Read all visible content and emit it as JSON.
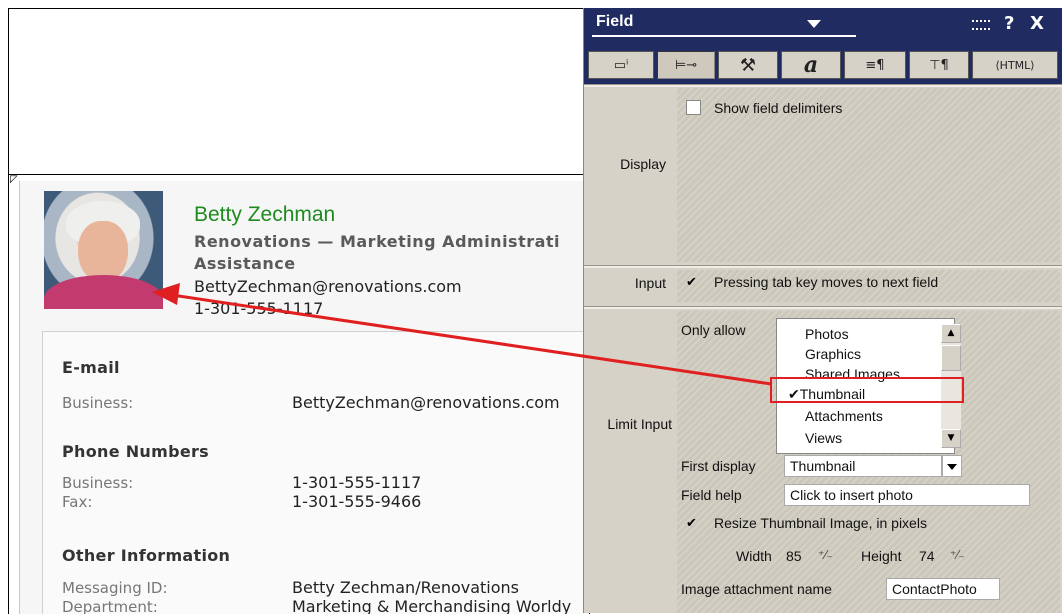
{
  "contact": {
    "name": "Betty Zechman",
    "title_line1": "Renovations — Marketing Administrati",
    "title_line2": "Assistance",
    "email": "BettyZechman@renovations.com",
    "phone": "1-301-555-1117"
  },
  "details": {
    "email_section": "E-mail",
    "email_label": "Business:",
    "email_value": "BettyZechman@renovations.com",
    "phone_section": "Phone Numbers",
    "phone_business_label": "Business:",
    "phone_business_value": "1-301-555-1117",
    "phone_fax_label": "Fax:",
    "phone_fax_value": "1-301-555-9466",
    "other_section": "Other Information",
    "messaging_label": "Messaging ID:",
    "messaging_value": "Betty Zechman/Renovations",
    "department_label": "Department:",
    "department_value": "Marketing & Merchandising Worldy"
  },
  "field_box": {
    "title": "Field",
    "help_label": "?",
    "close_label": "X",
    "tabs": [
      {
        "name": "info-tab-icon",
        "label": "▭ⁱ"
      },
      {
        "name": "control-tab-icon",
        "label": "⊨⊸"
      },
      {
        "name": "extra-tab-icon",
        "label": "⚒"
      },
      {
        "name": "font-tab-icon",
        "label": "a"
      },
      {
        "name": "paragraph-tab-icon",
        "label": "≡¶"
      },
      {
        "name": "hide-tab-icon",
        "label": "⊤¶"
      },
      {
        "name": "html-tab-icon",
        "label": "⟨HTML⟩"
      }
    ],
    "display_label": "Display",
    "show_delimiters": "Show field delimiters",
    "input_label": "Input",
    "tab_key_option": "Pressing tab key moves to next field",
    "check_mark": "✔",
    "limit_label": "Limit Input",
    "only_allow": "Only allow",
    "allow_items": [
      "Photos",
      "Graphics",
      "Shared Images",
      "Thumbnail",
      "Attachments",
      "Views"
    ],
    "checked_item_mark": "✔",
    "first_display_label": "First display",
    "first_display_value": "Thumbnail",
    "field_help_label": "Field help",
    "field_help_value": "Click to insert photo",
    "resize_option": "Resize Thumbnail Image, in pixels",
    "width_label": "Width",
    "width_value": "85",
    "height_label": "Height",
    "height_value": "74",
    "attachment_label": "Image attachment name",
    "attachment_value": "ContactPhoto"
  },
  "colors": {
    "titlebar": "#1f2b61",
    "panel": "#d7d2c8",
    "highlight": "#e02020",
    "contact_name": "#1e8b1e"
  }
}
